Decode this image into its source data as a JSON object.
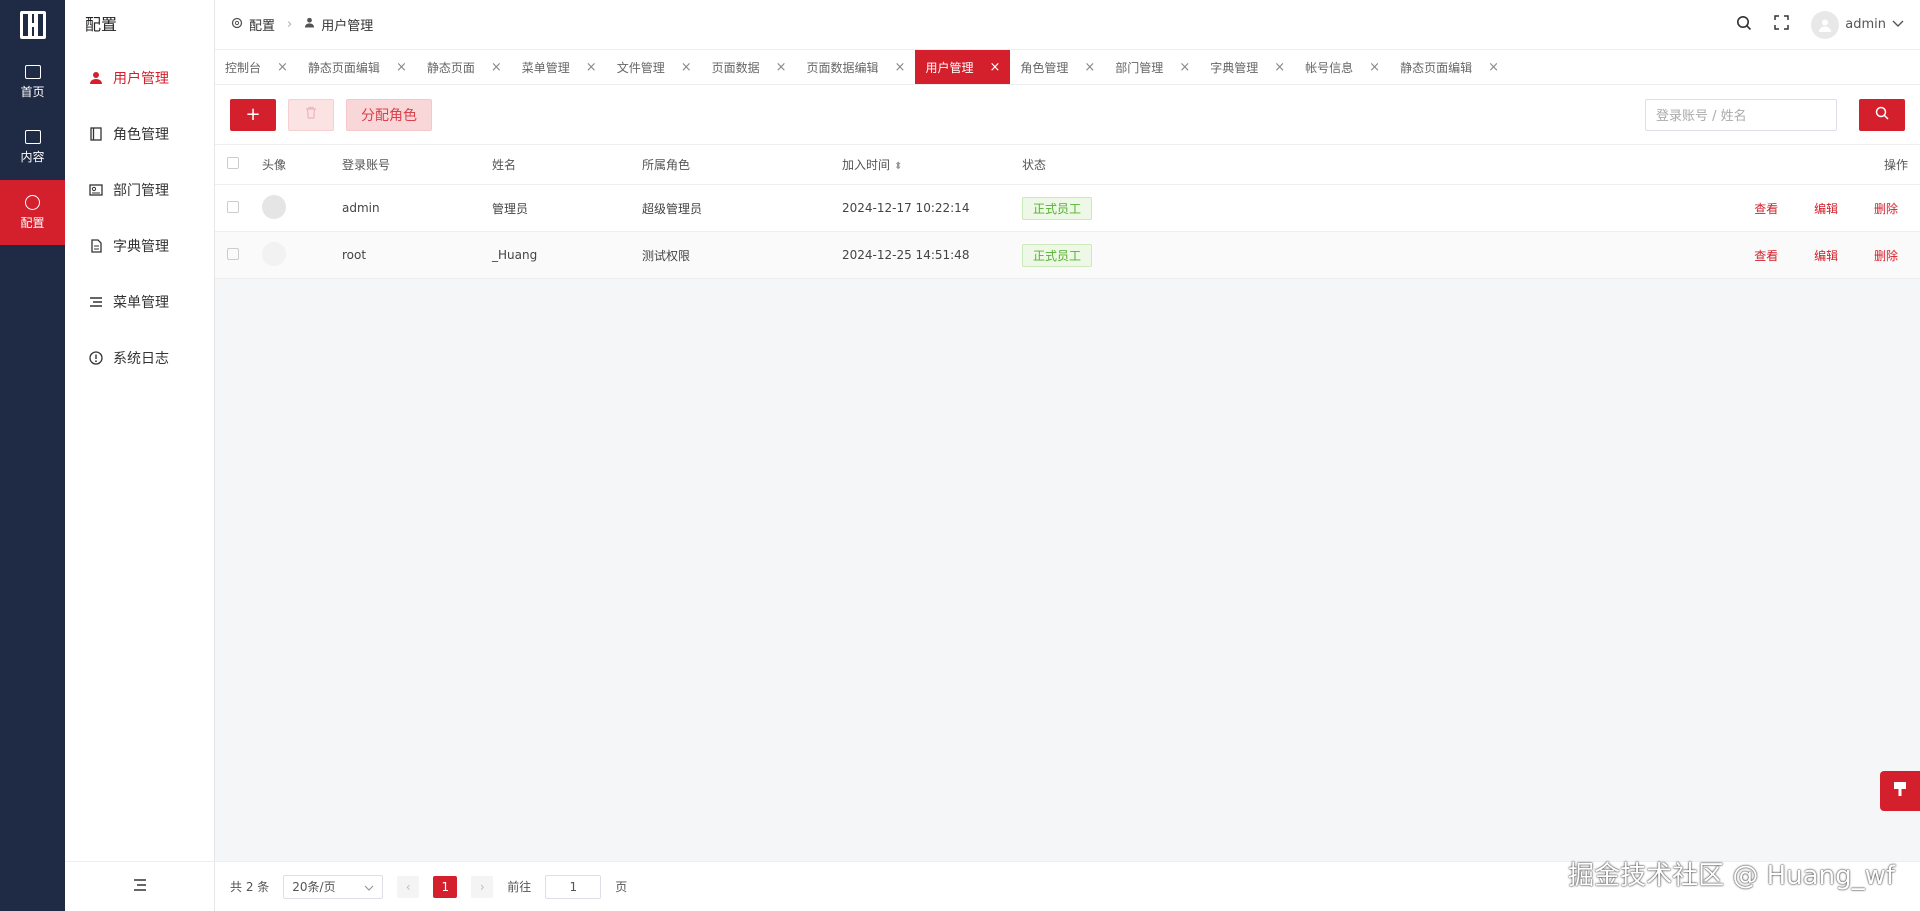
{
  "rail": {
    "items": [
      {
        "label": "首页"
      },
      {
        "label": "内容"
      },
      {
        "label": "配置"
      }
    ]
  },
  "sidebar": {
    "title": "配置",
    "items": [
      {
        "label": "用户管理"
      },
      {
        "label": "角色管理"
      },
      {
        "label": "部门管理"
      },
      {
        "label": "字典管理"
      },
      {
        "label": "菜单管理"
      },
      {
        "label": "系统日志"
      }
    ]
  },
  "header": {
    "breadcrumb": [
      "配置",
      "用户管理"
    ],
    "username": "admin"
  },
  "tabs": [
    "控制台",
    "静态页面编辑",
    "静态页面",
    "菜单管理",
    "文件管理",
    "页面数据",
    "页面数据编辑",
    "用户管理",
    "角色管理",
    "部门管理",
    "字典管理",
    "帐号信息",
    "静态页面编辑"
  ],
  "toolbar": {
    "add_label": "+",
    "assign_label": "分配角色",
    "search_placeholder": "登录账号 / 姓名"
  },
  "table": {
    "headers": [
      "头像",
      "登录账号",
      "姓名",
      "所属角色",
      "加入时间",
      "状态",
      "操作"
    ],
    "rows": [
      {
        "account": "admin",
        "name": "管理员",
        "role": "超级管理员",
        "joined": "2024-12-17 10:22:14",
        "status": "正式员工"
      },
      {
        "account": "root",
        "name": "_Huang",
        "role": "测试权限",
        "joined": "2024-12-25 14:51:48",
        "status": "正式员工"
      }
    ],
    "actions": {
      "view": "查看",
      "edit": "编辑",
      "delete": "删除"
    }
  },
  "pager": {
    "total": "共 2 条",
    "page_size": "20条/页",
    "current_page": "1",
    "goto_prefix": "前往",
    "goto_value": "1",
    "goto_suffix": "页"
  },
  "watermark": "掘金技术社区 @ Huang_wf",
  "colors": {
    "accent": "#d4202c",
    "rail": "#1f2a44",
    "status": "#52b22c"
  }
}
